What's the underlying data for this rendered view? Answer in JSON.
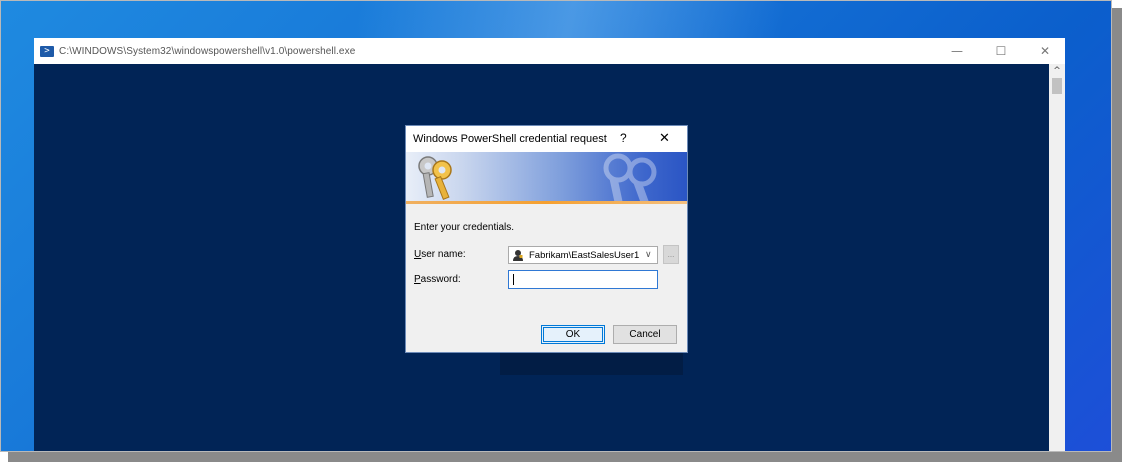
{
  "console_window": {
    "title": "C:\\WINDOWS\\System32\\windowspowershell\\v1.0\\powershell.exe",
    "controls": {
      "minimize": "—",
      "maximize": "☐",
      "close": "✕"
    },
    "scroll_up": "^",
    "background_color": "#012456",
    "icon": "powershell-icon"
  },
  "dialog": {
    "title": "Windows PowerShell credential request",
    "help_label": "?",
    "close_label": "✕",
    "prompt": "Enter your credentials.",
    "user_name_label_underlined": "U",
    "user_name_label_rest": "ser name:",
    "password_label_underlined": "P",
    "password_label_rest": "assword:",
    "user_name_value": "Fabrikam\\EastSalesUser1",
    "password_value": "",
    "browse_label": "...",
    "ok_label": "OK",
    "cancel_label": "Cancel",
    "banner_icon": "keys-icon",
    "user_icon": "user-account-icon"
  },
  "colors": {
    "accent": "#0078d7",
    "desktop": "#1673d6",
    "console": "#012456"
  }
}
